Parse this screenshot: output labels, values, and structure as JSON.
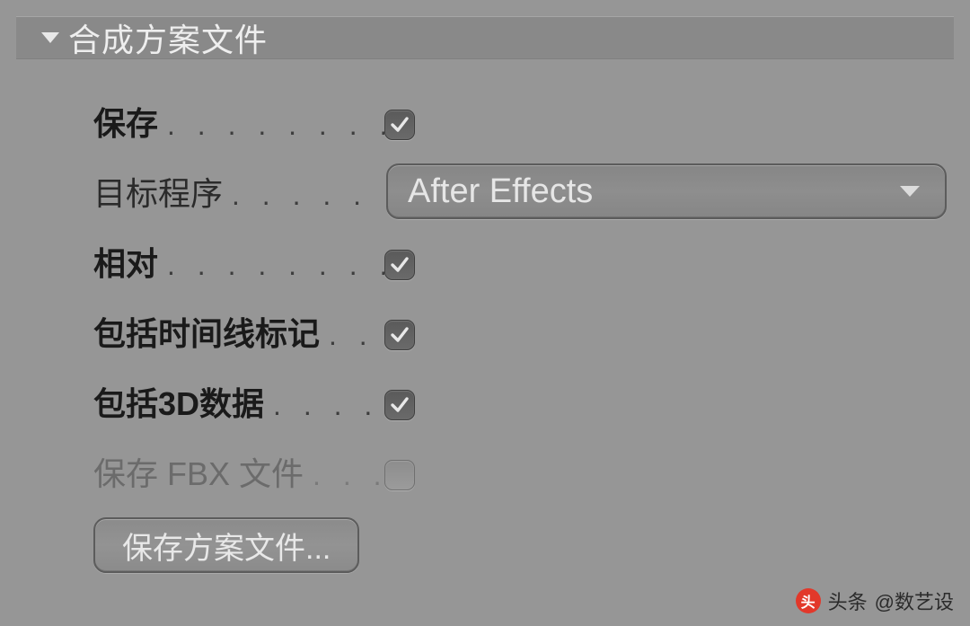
{
  "section": {
    "title": "合成方案文件"
  },
  "rows": {
    "save": {
      "label": "保存",
      "checked": true,
      "bold": true
    },
    "target": {
      "label": "目标程序",
      "value": "After Effects"
    },
    "relative": {
      "label": "相对",
      "checked": true,
      "bold": true
    },
    "markers": {
      "label": "包括时间线标记",
      "checked": true,
      "bold": true
    },
    "data3d": {
      "label": "包括3D数据",
      "checked": true,
      "bold": true
    },
    "fbx": {
      "label": "保存 FBX 文件",
      "checked": false,
      "disabled": true
    }
  },
  "button": {
    "label": "保存方案文件..."
  },
  "watermark": {
    "source": "头条",
    "author": "@数艺设"
  }
}
